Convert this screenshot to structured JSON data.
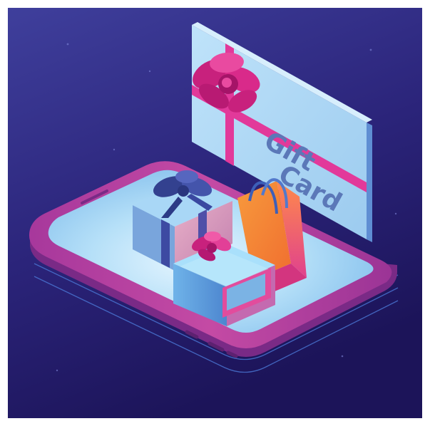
{
  "illustration": {
    "card_title_line1": "Gift",
    "card_title_line2": "Card"
  },
  "colors": {
    "frame": "#ffffff",
    "background_top": "#3b3a95",
    "background_bottom": "#1f1760",
    "phone_body": "#b93f9e",
    "phone_edge": "#8a2c86",
    "screen": "#a9dcf5",
    "card_face": "#a9d7f2",
    "card_edge": "#6fa6dd",
    "ribbon": "#e2399a",
    "card_text": "#5b78b8",
    "gift_blue": "#6aa4de",
    "bow_navy": "#3d4aa2",
    "bag_orange": "#f28a3a",
    "bag_pink": "#e7438e"
  }
}
